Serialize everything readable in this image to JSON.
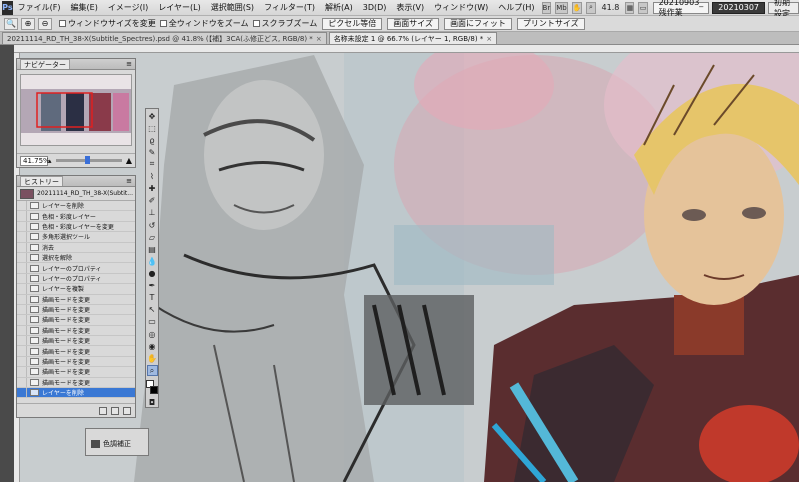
{
  "menubar": {
    "logo": "Ps",
    "items": [
      "ファイル(F)",
      "編集(E)",
      "イメージ(I)",
      "レイヤー(L)",
      "選択範囲(S)",
      "フィルター(T)",
      "解析(A)",
      "3D(D)",
      "表示(V)",
      "ウィンドウ(W)",
      "ヘルプ(H)"
    ],
    "zoom": "41.8",
    "workspaces": [
      "20210903_残作業",
      "20210307",
      "初期設定"
    ]
  },
  "options": {
    "checkboxes": [
      "ウィンドウサイズを変更",
      "全ウィンドウをズーム",
      "スクラブズーム"
    ],
    "buttons": [
      "ピクセル等倍",
      "画面サイズ",
      "画面にフィット",
      "プリントサイズ"
    ]
  },
  "tabs": [
    {
      "label": "20211114_RD_TH_38-X(Subtitle_Spectres).psd @ 41.8% (【補】3CA(ふ修正どス, RGB/8) *",
      "close": "×"
    },
    {
      "label": "名称未設定 1 @ 66.7% (レイヤー 1, RGB/8) *",
      "close": "×"
    }
  ],
  "navigator": {
    "title": "ナビゲーター",
    "zoom": "41.75%"
  },
  "history": {
    "title": "ヒストリー",
    "snapshot": "20211114_RD_TH_38-X(Subtit...",
    "items": [
      "レイヤーを削除",
      "色相・彩度レイヤー",
      "色相・彩度レイヤーを変更",
      "多角形選択ツール",
      "消去",
      "選択を解除",
      "レイヤーのプロパティ",
      "レイヤーのプロパティ",
      "レイヤーを複製",
      "描画モードを変更",
      "描画モードを変更",
      "描画モードを変更",
      "描画モードを変更",
      "描画モードを変更",
      "描画モードを変更",
      "描画モードを変更",
      "描画モードを変更",
      "描画モードを変更",
      "レイヤーを削除"
    ],
    "selected_index": 18
  },
  "adjust": {
    "label": "色調補正"
  },
  "colors": {
    "selection": "#3a78d4",
    "canvas_bg": "#c9cfd1"
  }
}
